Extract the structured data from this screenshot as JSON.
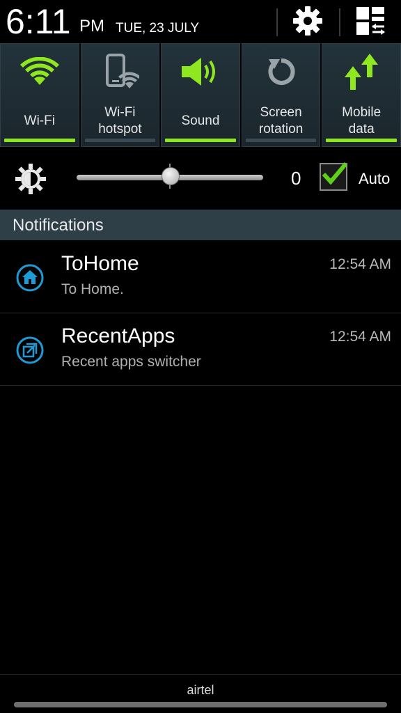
{
  "header": {
    "time": "6:11",
    "ampm": "PM",
    "date": "TUE, 23 JULY",
    "settings_icon": "gear-icon",
    "panel_icon": "panel-edit-icon"
  },
  "toggles": [
    {
      "label": "Wi-Fi",
      "icon": "wifi-icon",
      "state": "on"
    },
    {
      "label": "Wi-Fi\nhotspot",
      "icon": "wifi-hotspot-icon",
      "state": "off"
    },
    {
      "label": "Sound",
      "icon": "sound-icon",
      "state": "on"
    },
    {
      "label": "Screen\nrotation",
      "icon": "screen-rotation-icon",
      "state": "off"
    },
    {
      "label": "Mobile\ndata",
      "icon": "mobile-data-icon",
      "state": "on"
    }
  ],
  "brightness": {
    "icon": "brightness-icon",
    "value": "0",
    "auto_label": "Auto",
    "auto_checked": true,
    "slider_fraction": 0.5
  },
  "notifications": {
    "header": "Notifications",
    "items": [
      {
        "title": "ToHome",
        "text": "To Home.",
        "time": "12:54 AM",
        "icon": "home-icon"
      },
      {
        "title": "RecentApps",
        "text": "Recent apps switcher",
        "time": "12:54 AM",
        "icon": "recent-apps-icon"
      }
    ]
  },
  "carrier": {
    "name": "airtel"
  },
  "colors": {
    "accent_green": "#8fe81f",
    "toggle_bg": "#1e2a30",
    "notif_header_bg": "#2e3f47",
    "notif_icon_blue": "#1e9ad6"
  }
}
